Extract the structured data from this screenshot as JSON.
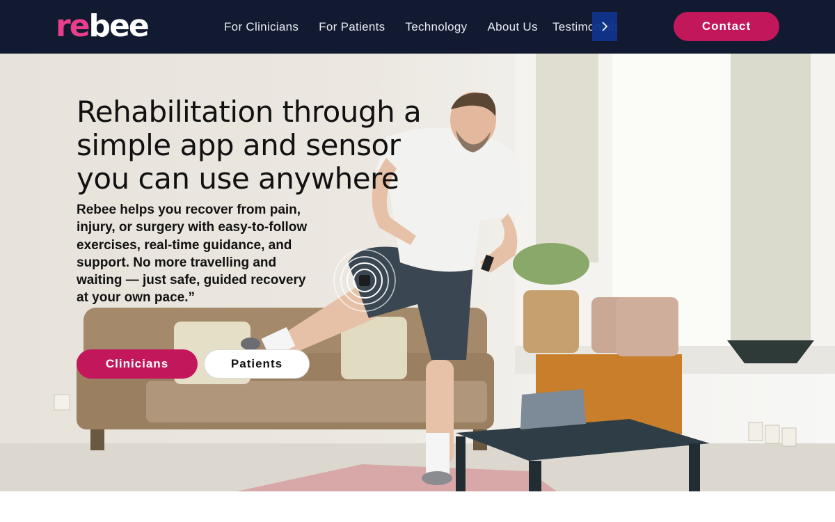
{
  "brand": {
    "logo_re": "re",
    "logo_bee": "bee"
  },
  "nav": {
    "links": [
      "For Clinicians",
      "For Patients",
      "Technology",
      "About Us"
    ],
    "overflow_link": "Testimonials",
    "more_icon": "chevron-right-icon",
    "contact_label": "Contact"
  },
  "hero": {
    "title": "Rehabilitation through a simple app and sensor you can use anywhere",
    "description": "Rebee helps you recover from pain, injury, or surgery with easy-to-follow exercises, real-time guidance, and support. No more travelling and waiting — just safe, guided recovery at your own pace.”",
    "btn_clinicians": "Clinicians",
    "btn_patients": "Patients",
    "image_subject": "man-exercising-with-knee-sensor"
  },
  "colors": {
    "nav_bg": "#111a30",
    "accent": "#c2185b",
    "logo_pink": "#e83e8c",
    "arrow_bg": "#10348c"
  }
}
